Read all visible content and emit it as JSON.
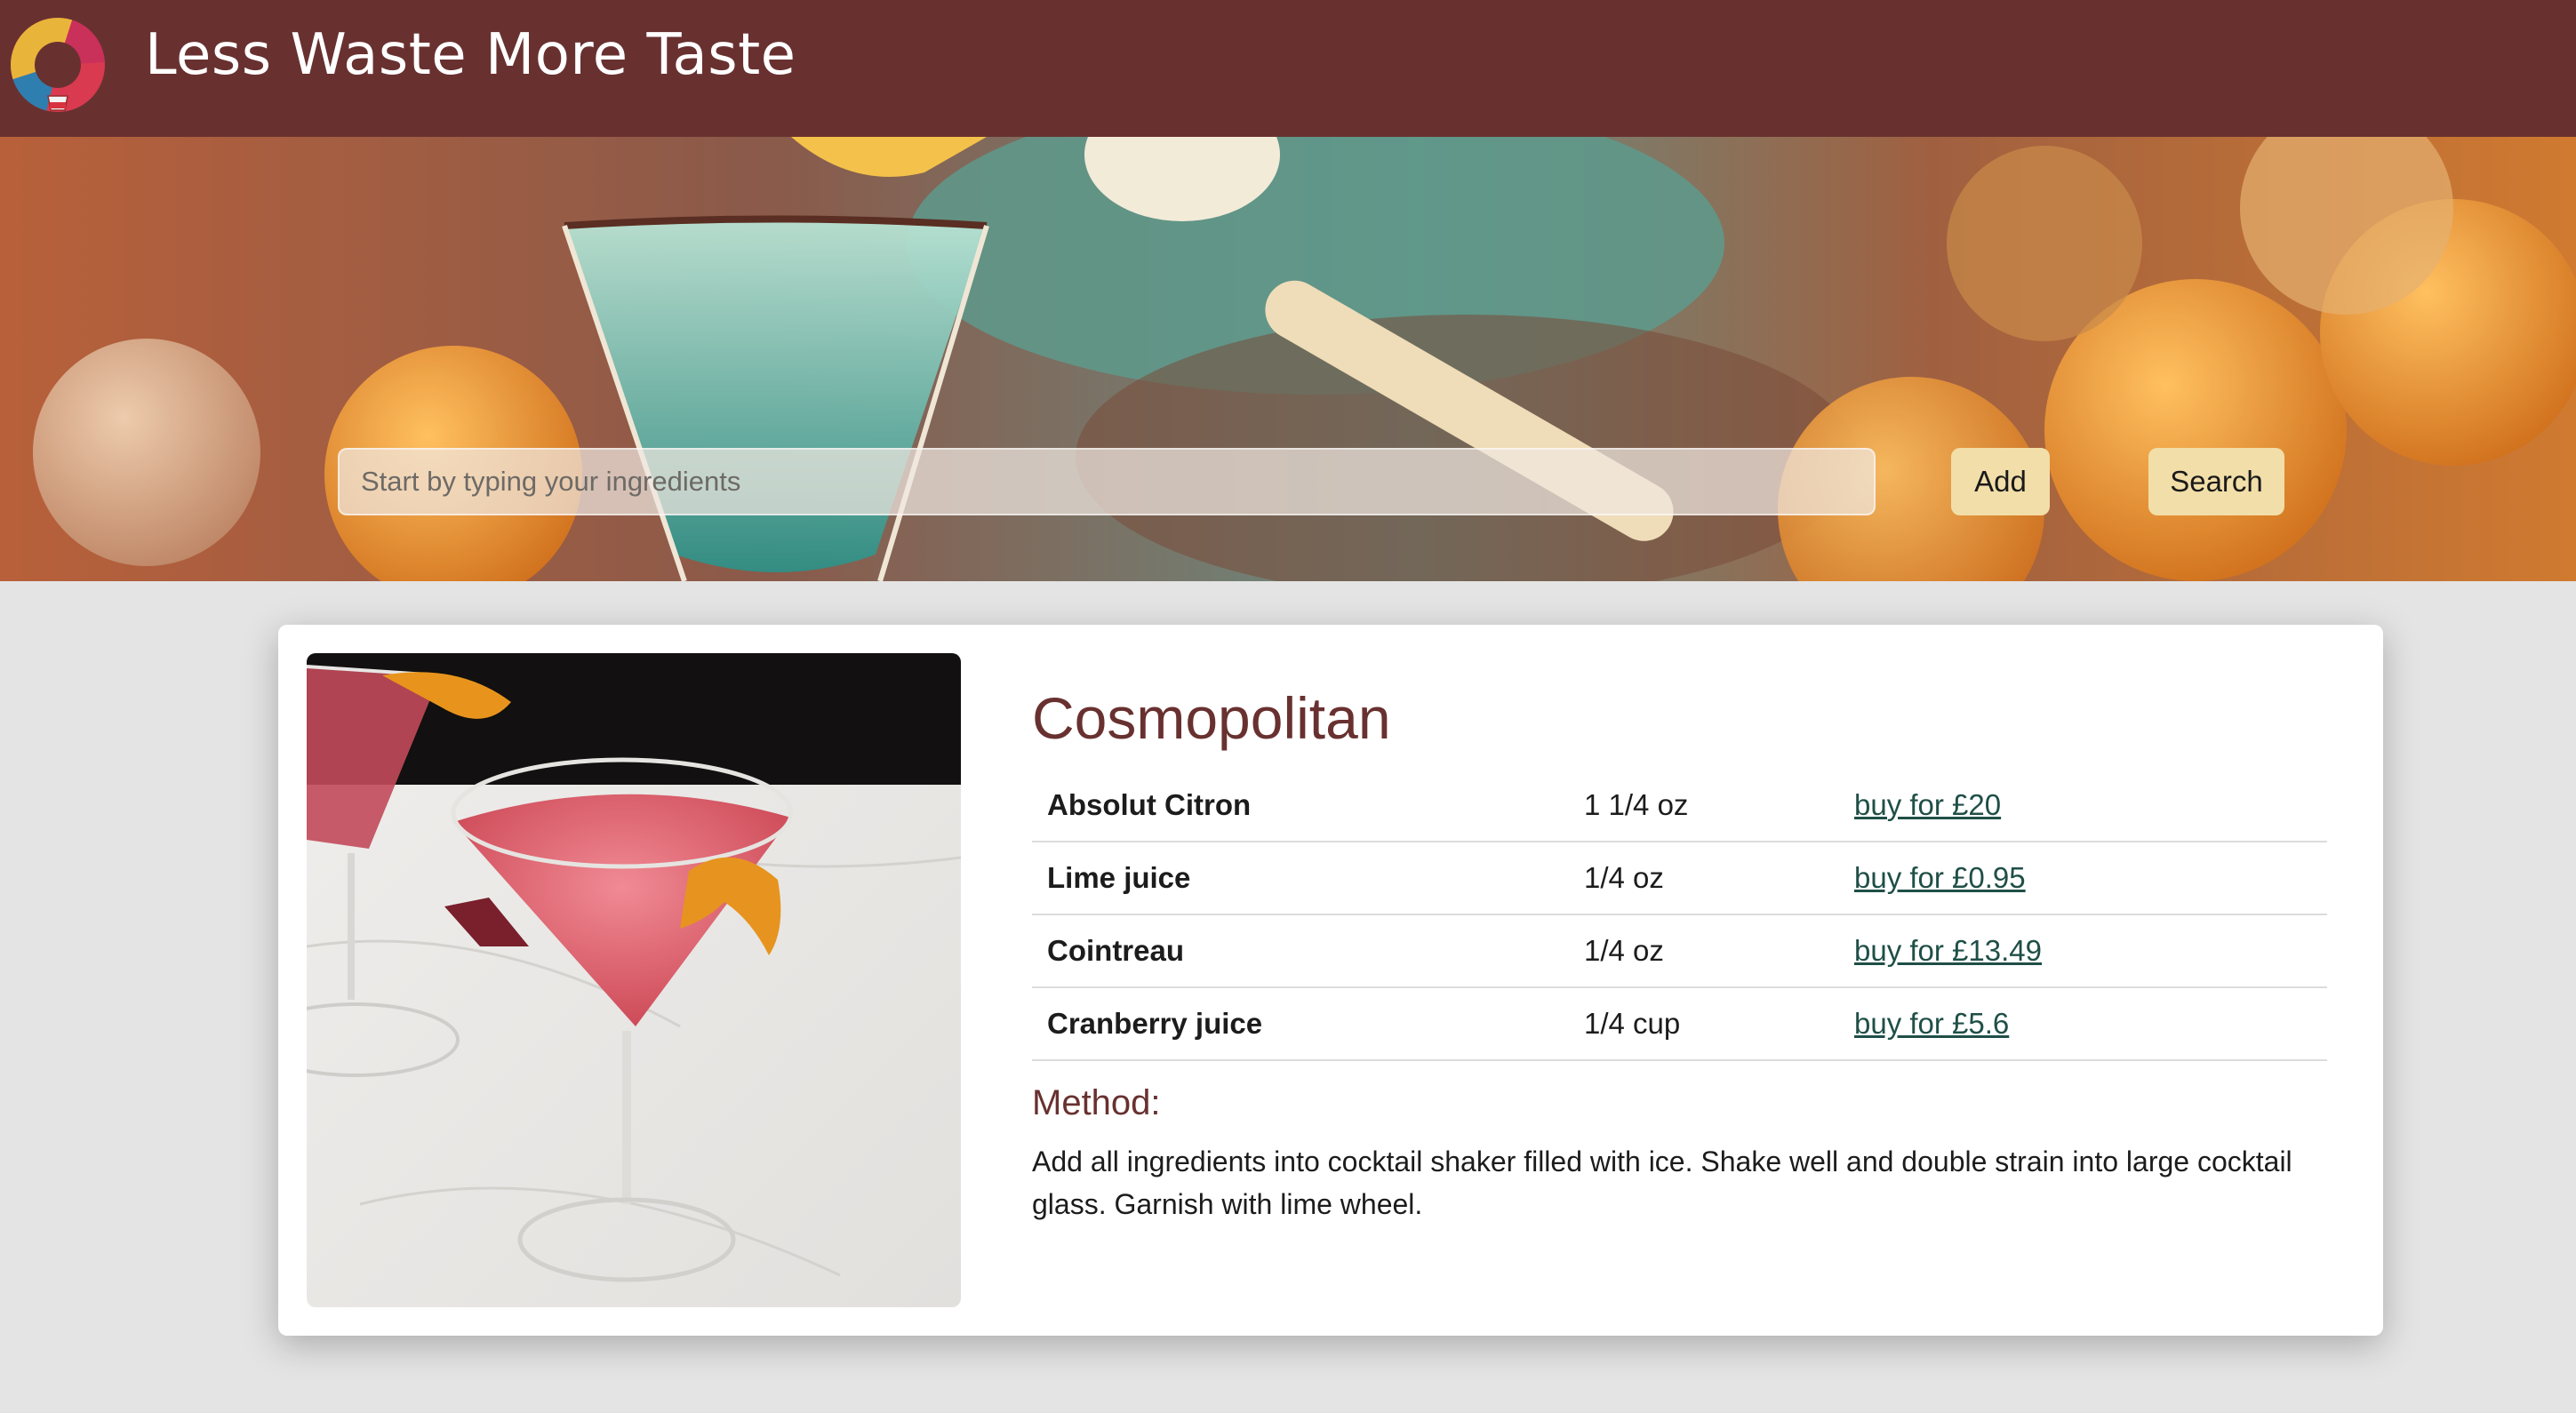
{
  "header": {
    "title": "Less Waste More Taste"
  },
  "search": {
    "placeholder": "Start by typing your ingredients",
    "add_label": "Add",
    "search_label": "Search"
  },
  "recipe": {
    "name": "Cosmopolitan",
    "ingredients": [
      {
        "name": "Absolut Citron",
        "amount": "1 1/4 oz",
        "buy": "buy for £20"
      },
      {
        "name": "Lime juice",
        "amount": "1/4 oz",
        "buy": "buy for £0.95"
      },
      {
        "name": "Cointreau",
        "amount": "1/4 oz",
        "buy": "buy for £13.49"
      },
      {
        "name": "Cranberry juice",
        "amount": "1/4 cup",
        "buy": "buy for £5.6"
      }
    ],
    "method_heading": "Method:",
    "method_text": "Add all ingredients into cocktail shaker filled with ice. Shake well and double strain into large cocktail glass. Garnish with lime wheel."
  },
  "colors": {
    "header_bg": "#683130",
    "accent": "#683130",
    "button_bg": "#f2dea8",
    "link": "#1f4f47",
    "page_bg": "#e4e4e4"
  }
}
